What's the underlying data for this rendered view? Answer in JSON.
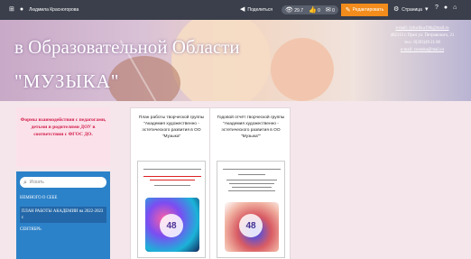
{
  "topbar": {
    "user_name": "Людмила Красногорова",
    "share_label": "Поделиться",
    "views": "29.7",
    "likes": "0",
    "comments": "0",
    "edit_label": "Редактировать",
    "page_menu_label": "Страница"
  },
  "banner": {
    "title_line1": "в Образовательной Области",
    "title_line2": "\"МУЗЫКА\"",
    "contact_email": "e-mail: lyduchka19tk@mail.ru",
    "contact_address": "482113 г. Орел ул. Петровского, 21",
    "contact_phone": "тел.: 8(393)49 21 00",
    "contact_email2": "e-mail: swstaka@mail.ru"
  },
  "sidebar": {
    "card_text": "Формы взаимодействия с педагогами, детьми и родителями ДОУ в соответствии с ФГОС ДО.",
    "search_placeholder": "Искать",
    "items": [
      {
        "label": "НЕМНОГО О СЕБЕ"
      },
      {
        "label": "ПЛАН РАБОТЫ АКАДЕМИИ на 2022-2023 г."
      },
      {
        "label": "СЕНТЯБРЬ"
      }
    ]
  },
  "documents": [
    {
      "title": "План работы творческой группы \"Академия художественно - эстетического развития в ОО \"Музыка\"",
      "cover_logo": "48"
    },
    {
      "title": "Годовой отчёт творческой группы \"Академия художественно - эстетического развития в ОО \"Музыка\"\"",
      "cover_logo": "48"
    }
  ],
  "colors": {
    "topbar": "#3a3f4b",
    "edit_button": "#f28c1c",
    "sidebar": "#2c82c9",
    "card_text": "#d21a4a"
  }
}
